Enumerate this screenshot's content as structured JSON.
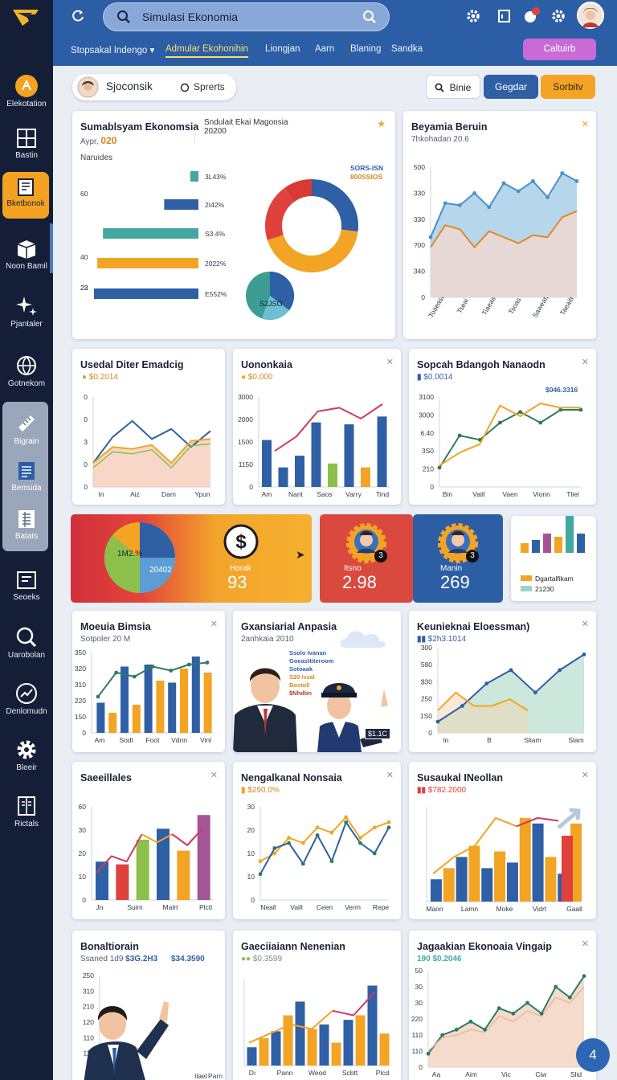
{
  "app": {
    "search_value": "Simulasi Ekonomia"
  },
  "topmenu": {
    "items": [
      "Stopsakal Indengo ▾",
      "Admular Ekohonihin",
      "Liongjan",
      "Aarn",
      "Blaning",
      "Sandka"
    ],
    "selected_index": 1,
    "cta": "Caltuirb"
  },
  "sidebar": {
    "items": [
      {
        "label": "Elekotation",
        "icon": "sun-badge-icon"
      },
      {
        "label": "Bastin",
        "icon": "grid-icon"
      },
      {
        "label": "Bketbonok",
        "icon": "book-icon"
      },
      {
        "label": "Noon Bamil",
        "icon": "box-icon"
      },
      {
        "label": "Pjantaler",
        "icon": "sparkle-icon"
      },
      {
        "label": "Gotnekom",
        "icon": "globe-icon"
      },
      {
        "label": "Bigrain",
        "icon": "ruler-icon"
      },
      {
        "label": "Bemuda",
        "icon": "list-doc-icon"
      },
      {
        "label": "Batats",
        "icon": "ledger-icon"
      },
      {
        "label": "Seoeks",
        "icon": "frame-icon"
      },
      {
        "label": "Uarobolan",
        "icon": "search-circle-icon"
      },
      {
        "label": "Denlomudn",
        "icon": "chart-circle-icon"
      },
      {
        "label": "Bleeir",
        "icon": "gear-icon"
      },
      {
        "label": "Rictals",
        "icon": "book-open-icon"
      }
    ]
  },
  "toolbar": {
    "scenario_label": "Sjoconsik",
    "radio_label": "Sprerts",
    "search_btn": "Binie",
    "btn_blue": "Gegdar",
    "btn_orange": "Sorbitv"
  },
  "cards": {
    "c1": {
      "title": "Sumablsyam Ekonomsia",
      "sub": "Aypr,",
      "sub_value": "020",
      "title2": "Sndulait Ekai Magonsia",
      "sub2": "20200",
      "list_heading": "Naruides",
      "donut_note1": "SORS-ISN",
      "donut_note2": "800SSIOS",
      "small_pie_label": "S2JSO"
    },
    "c2": {
      "title": "Beyamia Beruin",
      "sub": "7hkohadan 20.6"
    },
    "c3": {
      "title": "Usedal Diter Emadcig",
      "badge": "$0.2014"
    },
    "c4": {
      "title": "Uononkaia",
      "badge": "$0.000"
    },
    "c5": {
      "title": "Sopcah Bdangoh Nanaodn",
      "badge": "$0.0014",
      "note": "$046.3316"
    },
    "c6": {
      "title": "Moeuia Bimsia",
      "sub": "Sotpoler 20 M"
    },
    "c7": {
      "title": "Gxansiarial Anpasia",
      "sub": "2anhkaia 2010",
      "notes": [
        "Ssolo Ivanan",
        "Goeasttiteroom",
        "Sotoaak",
        "S20 ivzal",
        "Bostoll",
        "$Nhdbn"
      ],
      "sign": "$1.1C"
    },
    "c8": {
      "title": "Keunieknai Eloessman)",
      "badge": "$2h3.1014"
    },
    "c9": {
      "title": "Saeeillales"
    },
    "c10": {
      "title": "Nengalkanal Nonsaia",
      "badge": "$290,0%"
    },
    "c11": {
      "title": "Susaukal INeollan",
      "badge": "$782.2000"
    },
    "c12": {
      "title": "Bonaltiorain",
      "sub": "Ssaned 1d9",
      "badge_a": "$3G.2H3",
      "badge_b": "$34.3590"
    },
    "c13": {
      "title": "Gaeciiaiann Nenenian",
      "badge": "$0.3599"
    },
    "c14": {
      "title": "Jagaakian Ekonoaia Vingaip",
      "badge_a": "190",
      "badge_b": "$0.2046"
    }
  },
  "stats": {
    "pie_label1": "1M2.%",
    "pie_label2": "20402",
    "m1_label": "Horak",
    "m1_value": "93",
    "m2_label": "Itsno",
    "m2_value": "2.98",
    "m3_label": "Manin",
    "m3_value": "269",
    "badge1": "3",
    "badge2": "3",
    "legend1": "Dgartalfikam",
    "legend2": "21230"
  },
  "fab": {
    "label": "4"
  },
  "colors": {
    "blue": "#2f5fa5",
    "orange": "#f3a424",
    "teal": "#43a8a2",
    "red": "#e0413d",
    "green": "#8dc04a",
    "purple": "#a45596",
    "navy": "#141f37"
  },
  "chart_data": [
    {
      "type": "bar",
      "orientation": "horizontal",
      "title": "Sumablsyam Ekonomsia",
      "categories": [
        "a",
        "b",
        "c",
        "d",
        "e"
      ],
      "values": [
        10,
        42,
        117,
        124,
        128
      ],
      "ytick_labels": [
        "60",
        "40",
        "23",
        "22"
      ],
      "value_labels": [
        "3L43%",
        "2I42%",
        "S3.4%",
        "2022%",
        "E552%"
      ]
    },
    {
      "type": "pie",
      "title": "Sndulait Ekai Magonsia",
      "values": [
        27,
        43,
        20,
        10
      ]
    },
    {
      "type": "area",
      "title": "Beyamia Beruin",
      "categories": [
        "Toaeasb",
        "Tseai",
        "Tiaeas",
        "Tsoas",
        "Saweats",
        "Taeaitt"
      ],
      "series": [
        {
          "values": [
            30,
            47,
            46,
            52,
            45,
            57,
            53,
            58,
            50,
            62,
            58
          ]
        },
        {
          "values": [
            25,
            36,
            34,
            25,
            33,
            30,
            27,
            31,
            30,
            40,
            43
          ]
        }
      ],
      "ytick_labels": [
        "500",
        "330",
        "330",
        "?00",
        "340",
        "0"
      ]
    },
    {
      "type": "line",
      "title": "Usedal Diter Emadcig",
      "categories": [
        "In",
        "Aiz",
        "Dam",
        "Ypun"
      ],
      "series": [
        {
          "values": [
            12,
            25,
            33,
            24,
            29,
            20,
            28
          ]
        },
        {
          "values": [
            12,
            20,
            19,
            21,
            12,
            23,
            24
          ]
        }
      ],
      "ytick_labels": [
        "0",
        "0",
        "3",
        "0",
        "0"
      ]
    },
    {
      "type": "bar",
      "title": "Uononkaia",
      "categories": [
        "Am",
        "Nant",
        "Saos",
        "Varry",
        "Tind"
      ],
      "series": [
        {
          "values": [
            24,
            10,
            16,
            33,
            12,
            32,
            10,
            36
          ]
        },
        {
          "values": [
            20,
            28,
            42,
            44,
            38,
            46
          ]
        }
      ],
      "ytick_labels": [
        "3000",
        "2000",
        "1500",
        "1150",
        "0"
      ]
    },
    {
      "type": "line",
      "title": "Sopcah Bdangoh Nanaodn",
      "categories": [
        "Bin",
        "Vaill",
        "Vaen",
        "Vionn",
        "Tliel"
      ],
      "series": [
        {
          "values": [
            9,
            24,
            22,
            30,
            35,
            30,
            36,
            36
          ]
        },
        {
          "values": [
            10,
            16,
            20,
            38,
            33,
            39,
            37,
            37
          ]
        }
      ],
      "ytick_labels": [
        "3100",
        "3000",
        "6.40",
        "3S0",
        "210",
        "0"
      ]
    },
    {
      "type": "bar",
      "title": "Moeuia Bimsia",
      "categories": [
        "Am",
        "Sodl",
        "Foot",
        "Vdrin",
        "Vinl"
      ],
      "series": [
        {
          "values": [
            15,
            33,
            34,
            25,
            38
          ]
        },
        {
          "values": [
            10,
            14,
            26,
            32,
            30
          ]
        }
      ],
      "line": [
        18,
        30,
        28,
        33,
        31,
        34,
        35
      ],
      "ytick_labels": [
        "350",
        "320",
        "310",
        "220",
        "150",
        "0"
      ]
    },
    {
      "type": "area",
      "title": "Keunieknai Eloessman)",
      "categories": [
        "ln",
        "B",
        "Sliam",
        "Slam"
      ],
      "series": [
        {
          "values": [
            5,
            12,
            22,
            28,
            18,
            28,
            35
          ]
        },
        {
          "values": [
            10,
            18,
            12,
            12,
            15,
            10
          ]
        }
      ],
      "ytick_labels": [
        "300",
        "580",
        "$30",
        "250",
        "1S0",
        "0"
      ]
    },
    {
      "type": "bar",
      "title": "Saeeillales",
      "categories": [
        "Jn",
        "Suim",
        "Malrt",
        "Plctl"
      ],
      "series": [
        {
          "values": [
            14,
            13,
            22,
            26,
            18,
            31
          ]
        }
      ],
      "line": [
        10,
        16,
        14,
        24,
        21,
        24,
        20,
        26
      ],
      "ytick_labels": [
        "60",
        "30",
        "20",
        "10",
        "0"
      ]
    },
    {
      "type": "line",
      "title": "Nengalkanal Nonsaia",
      "categories": [
        "Neall",
        "Vaill",
        "Ceen",
        "Verm",
        "Repe"
      ],
      "series": [
        {
          "values": [
            10,
            20,
            22,
            14,
            25,
            15,
            30,
            22,
            18,
            28
          ]
        },
        {
          "values": [
            15,
            18,
            24,
            22,
            28,
            26,
            32,
            24,
            28,
            30
          ]
        }
      ],
      "ytick_labels": [
        "30",
        "20",
        "10",
        "10",
        "0"
      ]
    },
    {
      "type": "bar",
      "title": "Susaukal INeollan",
      "categories": [
        "Maon",
        "Lamn",
        "Moke",
        "Vidrt",
        "Gaall"
      ],
      "series": [
        {
          "values": [
            8,
            16,
            12,
            14,
            28,
            10
          ]
        },
        {
          "values": [
            12,
            20,
            18,
            30,
            16,
            28
          ]
        }
      ],
      "line": [
        10,
        16,
        20,
        30,
        27,
        30,
        29
      ],
      "ytick_labels": []
    },
    {
      "type": "bar",
      "title": "Bonaltiorain",
      "categories": [
        "Ilaet",
        "Parn"
      ],
      "series": [
        {
          "values": [
            10,
            30,
            26,
            22,
            35
          ]
        }
      ],
      "ytick_labels": [
        "250",
        "310",
        "210",
        "120",
        "110",
        "110",
        "0"
      ]
    },
    {
      "type": "bar",
      "title": "Gaeciiaiann Nenenian",
      "categories": [
        "Dı",
        "Pann",
        "Weod",
        "Scbtt",
        "Plcd"
      ],
      "series": [
        {
          "values": [
            8,
            15,
            28,
            18,
            20,
            35
          ]
        },
        {
          "values": [
            12,
            22,
            16,
            10,
            22,
            14
          ]
        }
      ],
      "line": [
        10,
        14,
        18,
        16,
        24,
        22,
        32
      ],
      "ytick_labels": []
    },
    {
      "type": "area",
      "title": "Jagaakian Ekonoaia Vingaip",
      "categories": [
        "Aa",
        "Aim",
        "Vic",
        "Ciw",
        "Slid"
      ],
      "series": [
        {
          "values": [
            5,
            12,
            14,
            17,
            14,
            22,
            20,
            24,
            20,
            30,
            26,
            34
          ]
        },
        {
          "values": [
            6,
            11,
            12,
            14,
            13,
            19,
            17,
            21,
            19,
            26,
            24,
            30
          ]
        }
      ],
      "ytick_labels": [
        "50",
        "30",
        "30",
        "220",
        "110",
        "110",
        "0"
      ]
    }
  ]
}
